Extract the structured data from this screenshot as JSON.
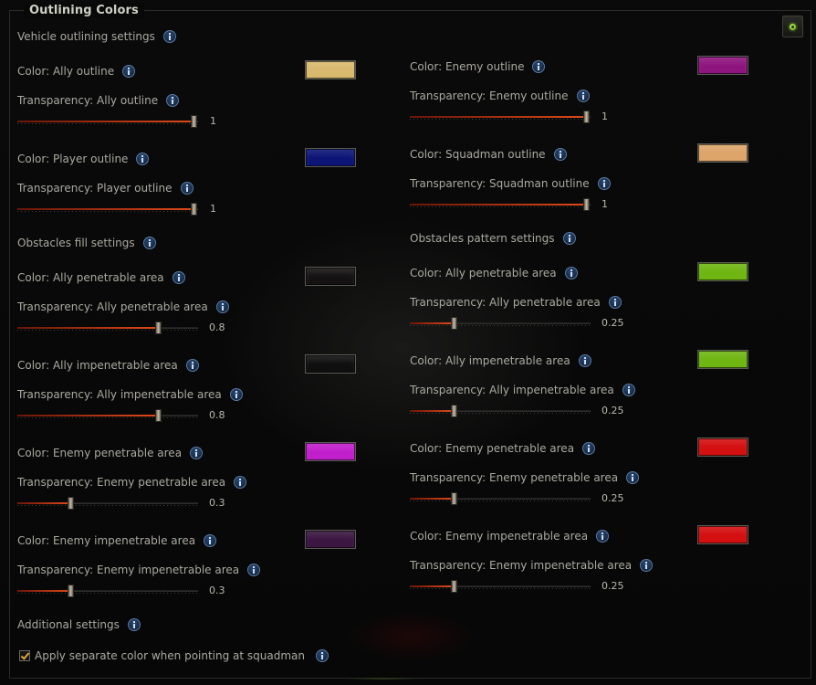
{
  "group_title": "Outlining Colors",
  "vehicle_header": "Vehicle outlining settings",
  "obstacles_fill_header": "Obstacles fill settings",
  "obstacles_pattern_header": "Obstacles pattern settings",
  "additional_header": "Additional settings",
  "apply_separate_label": "Apply separate color when pointing at squadman",
  "apply_separate_checked": true,
  "icons": {
    "info": "info-icon",
    "corner": "settings-toggle-icon",
    "check": "checkmark-icon"
  },
  "left": {
    "ally": {
      "color_label": "Color: Ally outline",
      "color": "#d9b96e",
      "transp_label": "Transparency: Ally outline",
      "value": "1"
    },
    "player": {
      "color_label": "Color: Player outline",
      "color": "#0c1576",
      "transp_label": "Transparency: Player outline",
      "value": "1"
    },
    "ally_pen": {
      "color_label": "Color: Ally penetrable area",
      "color": "#141212",
      "transp_label": "Transparency: Ally penetrable area",
      "value": "0.8"
    },
    "ally_impen": {
      "color_label": "Color: Ally impenetrable area",
      "color": "#0f0f0f",
      "transp_label": "Transparency: Ally impenetrable area",
      "value": "0.8"
    },
    "enemy_pen": {
      "color_label": "Color: Enemy penetrable area",
      "color": "#c21fcc",
      "transp_label": "Transparency: Enemy penetrable area",
      "value": "0.3"
    },
    "enemy_impen": {
      "color_label": "Color: Enemy impenetrable area",
      "color": "#3a1640",
      "transp_label": "Transparency: Enemy impenetrable area",
      "value": "0.3"
    }
  },
  "right": {
    "enemy": {
      "color_label": "Color: Enemy outline",
      "color": "#8f157e",
      "transp_label": "Transparency: Enemy outline",
      "value": "1"
    },
    "squadman": {
      "color_label": "Color: Squadman outline",
      "color": "#dda46a",
      "transp_label": "Transparency: Squadman outline",
      "value": "1"
    },
    "ally_pen": {
      "color_label": "Color: Ally penetrable area",
      "color": "#6fb613",
      "transp_label": "Transparency: Ally penetrable area",
      "value": "0.25"
    },
    "ally_impen": {
      "color_label": "Color: Ally impenetrable area",
      "color": "#6fb613",
      "transp_label": "Transparency: Ally impenetrable area",
      "value": "0.25"
    },
    "enemy_pen": {
      "color_label": "Color: Enemy penetrable area",
      "color": "#d40f0f",
      "transp_label": "Transparency: Enemy penetrable area",
      "value": "0.25"
    },
    "enemy_impen": {
      "color_label": "Color: Enemy impenetrable area",
      "color": "#d40f0f",
      "transp_label": "Transparency: Enemy impenetrable area",
      "value": "0.25"
    }
  }
}
